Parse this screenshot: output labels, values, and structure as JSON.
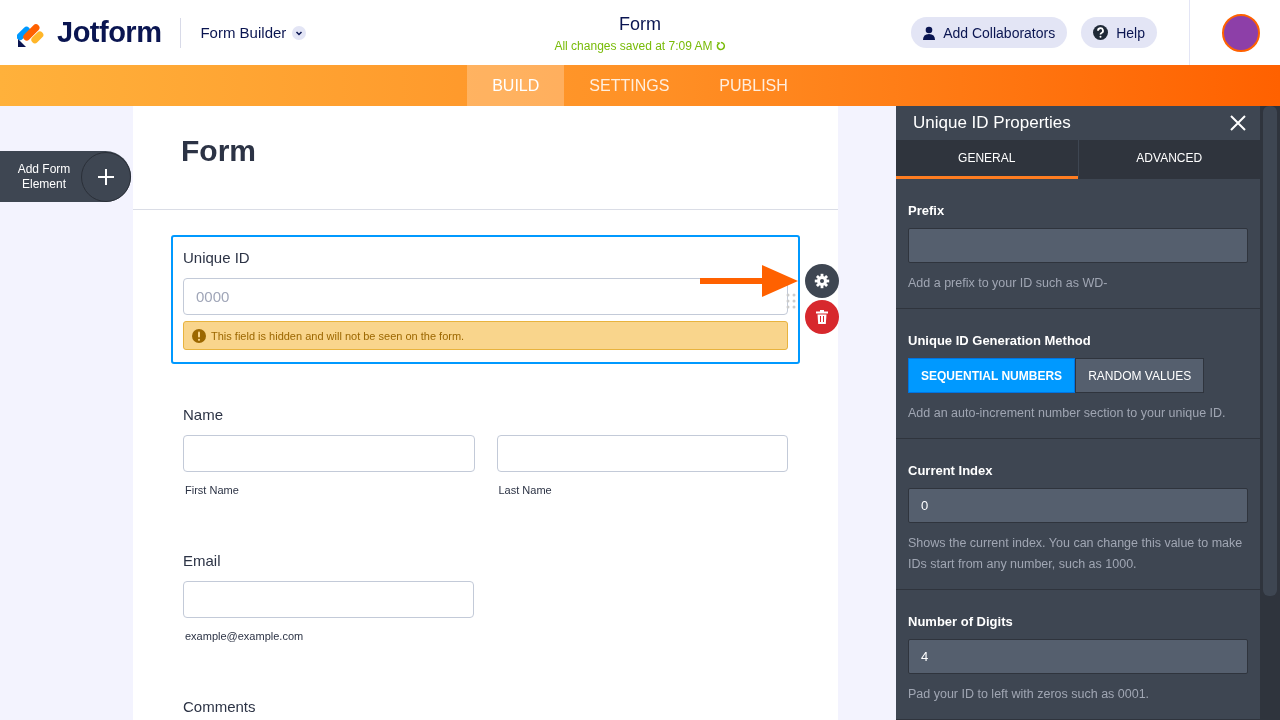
{
  "header": {
    "logo_text": "Jotform",
    "product": "Form Builder",
    "title": "Form",
    "save_status": "All changes saved at 7:09 AM",
    "buttons": [
      {
        "kind": "collaborators",
        "label": "Add Collaborators"
      },
      {
        "kind": "help",
        "label": "Help"
      }
    ]
  },
  "nav_tabs": [
    {
      "label": "BUILD",
      "selected": true
    },
    {
      "label": "SETTINGS",
      "selected": false
    },
    {
      "label": "PUBLISH",
      "selected": false
    }
  ],
  "add_element": {
    "label": "Add Form Element"
  },
  "form": {
    "title": "Form",
    "fields": [
      {
        "kind": "uniqueid",
        "label": "Unique ID",
        "placeholder": "0000",
        "notice": "This field is hidden and will not be seen on the form.",
        "selected": true
      },
      {
        "kind": "name",
        "label": "Name",
        "subfields": [
          "First Name",
          "Last Name"
        ],
        "selected": false
      },
      {
        "kind": "email",
        "label": "Email",
        "sublabel": "example@example.com",
        "selected": false
      },
      {
        "kind": "textarea",
        "label": "Comments",
        "selected": false
      }
    ]
  },
  "panel": {
    "title": "Unique ID Properties",
    "tabs": [
      {
        "label": "GENERAL",
        "selected": true
      },
      {
        "label": "ADVANCED",
        "selected": false
      }
    ],
    "sections": [
      {
        "kind": "input",
        "label": "Prefix",
        "help": "Add a prefix to your ID such as WD-"
      },
      {
        "kind": "toggle",
        "label": "Unique ID Generation Method",
        "options": [
          {
            "label": "SEQUENTIAL NUMBERS",
            "selected": true
          },
          {
            "label": "RANDOM VALUES",
            "selected": false
          }
        ],
        "help": "Add an auto-increment number section to your unique ID."
      },
      {
        "kind": "input",
        "label": "Current Index",
        "value": "0",
        "help": "Shows the current index. You can change this value to make IDs start from any number, such as 1000."
      },
      {
        "kind": "input",
        "label": "Number of Digits",
        "value": "4",
        "help": "Pad your ID to left with zeros such as 0001."
      }
    ]
  }
}
